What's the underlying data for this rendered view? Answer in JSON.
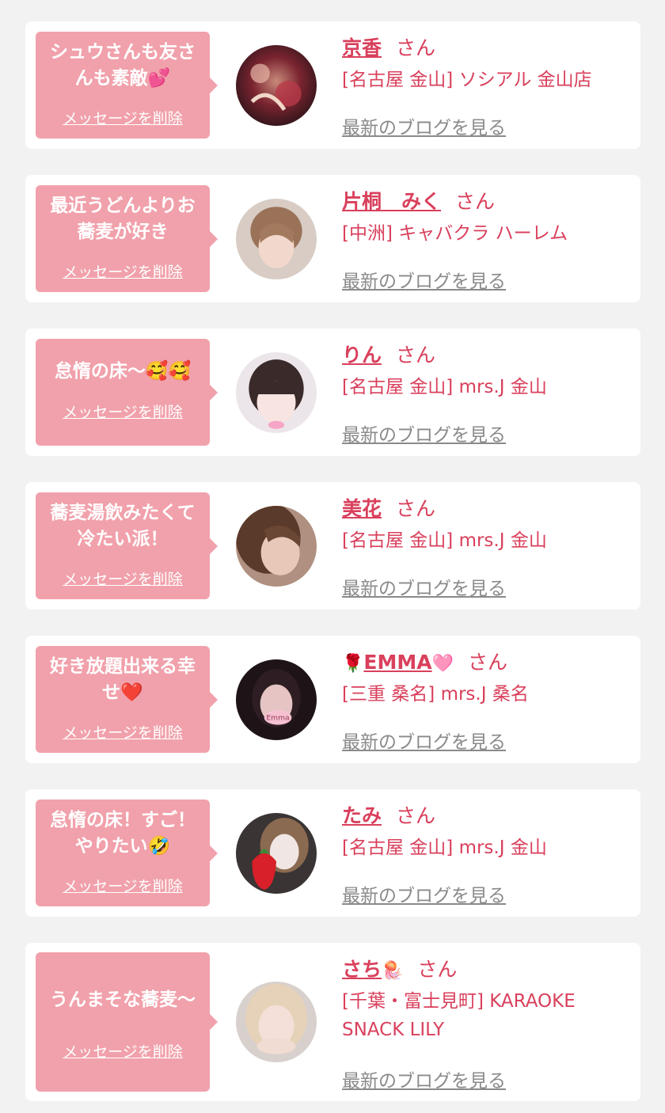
{
  "entries": [
    {
      "message": "シュウさんも友さんも素敵💕",
      "delete_label": "メッセージを削除",
      "name_prefix_icon": "",
      "name": "京香",
      "name_suffix_icon": "",
      "honorific": "さん",
      "shop": "[名古屋 金山] ソシアル 金山店",
      "blog_link": "最新のブログを見る",
      "avatar_icon": "profile-photo"
    },
    {
      "message": "最近うどんよりお蕎麦が好き",
      "delete_label": "メッセージを削除",
      "name_prefix_icon": "",
      "name": "片桐　みく",
      "name_suffix_icon": "",
      "honorific": "さん",
      "shop": "[中洲] キャバクラ ハーレム",
      "blog_link": "最新のブログを見る",
      "avatar_icon": "profile-photo"
    },
    {
      "message": "怠惰の床〜🥰🥰",
      "delete_label": "メッセージを削除",
      "name_prefix_icon": "",
      "name": "りん",
      "name_suffix_icon": "",
      "honorific": "さん",
      "shop": "[名古屋 金山] mrs.J 金山",
      "blog_link": "最新のブログを見る",
      "avatar_icon": "profile-photo"
    },
    {
      "message": "蕎麦湯飲みたくて冷たい派！",
      "delete_label": "メッセージを削除",
      "name_prefix_icon": "",
      "name": "美花",
      "name_suffix_icon": "",
      "honorific": "さん",
      "shop": "[名古屋 金山] mrs.J 金山",
      "blog_link": "最新のブログを見る",
      "avatar_icon": "profile-photo"
    },
    {
      "message": "好き放題出来る幸せ❤️",
      "delete_label": "メッセージを削除",
      "name_prefix_icon": "🌹",
      "name": "EMMA",
      "name_suffix_icon": "🩷",
      "honorific": "さん",
      "shop": "[三重 桑名] mrs.J 桑名",
      "blog_link": "最新のブログを見る",
      "avatar_icon": "profile-photo",
      "avatar_caption": "Emma"
    },
    {
      "message": "怠惰の床！すご！やりたい🤣",
      "delete_label": "メッセージを削除",
      "name_prefix_icon": "",
      "name": "たみ",
      "name_suffix_icon": "",
      "honorific": "さん",
      "shop": "[名古屋 金山] mrs.J 金山",
      "blog_link": "最新のブログを見る",
      "avatar_icon": "profile-photo"
    },
    {
      "message": "うんまそな蕎麦〜",
      "delete_label": "メッセージを削除",
      "name_prefix_icon": "",
      "name": "さち",
      "name_suffix_icon": "🪼",
      "honorific": "さん",
      "shop": "[千葉・富士見町] KARAOKE SNACK LILY",
      "blog_link": "最新のブログを見る",
      "avatar_icon": "profile-photo"
    }
  ],
  "colors": {
    "background": "#f2f2f2",
    "card": "#ffffff",
    "bubble": "#f1a1ab",
    "accent": "#d9405c",
    "link_gray": "#8a8a8a"
  }
}
